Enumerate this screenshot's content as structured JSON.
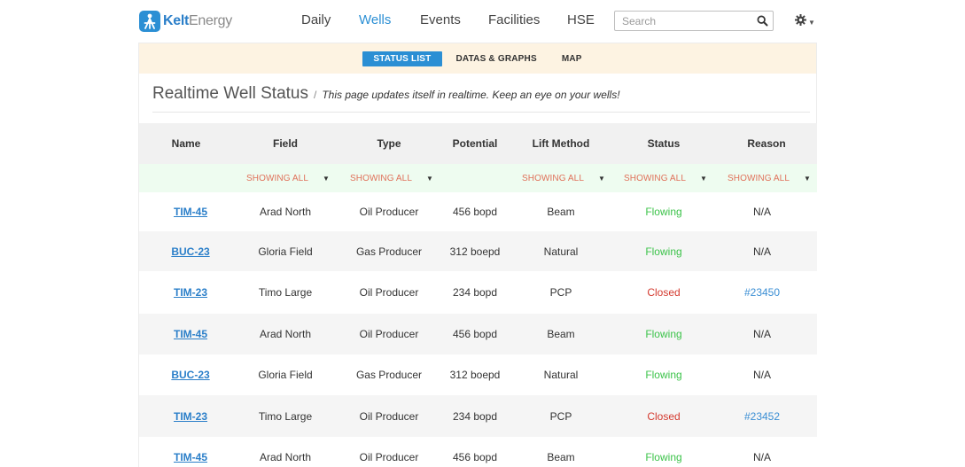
{
  "brand": {
    "name_part1": "Kelt",
    "name_part2": "Energy"
  },
  "nav": {
    "items": [
      {
        "label": "Daily"
      },
      {
        "label": "Wells",
        "active": true
      },
      {
        "label": "Events"
      },
      {
        "label": "Facilities"
      },
      {
        "label": "HSE"
      }
    ]
  },
  "search": {
    "placeholder": "Search",
    "value": ""
  },
  "subnav": {
    "tabs": [
      {
        "label": "STATUS LIST",
        "active": true
      },
      {
        "label": "DATAS & GRAPHS"
      },
      {
        "label": "MAP"
      }
    ]
  },
  "page": {
    "title": "Realtime Well Status",
    "separator": "/",
    "description": "This page updates itself in realtime. Keep an eye on your wells!"
  },
  "table": {
    "columns": [
      "Name",
      "Field",
      "Type",
      "Potential",
      "Lift Method",
      "Status",
      "Reason"
    ],
    "filter_label": "SHOWING ALL",
    "rows": [
      {
        "name": "TIM-45",
        "field": "Arad North",
        "type": "Oil Producer",
        "potential": "456 bopd",
        "lift": "Beam",
        "status": "Flowing",
        "reason": "N/A"
      },
      {
        "name": "BUC-23",
        "field": "Gloria Field",
        "type": "Gas Producer",
        "potential": "312 boepd",
        "lift": "Natural",
        "status": "Flowing",
        "reason": "N/A"
      },
      {
        "name": "TIM-23",
        "field": "Timo Large",
        "type": "Oil Producer",
        "potential": "234 bopd",
        "lift": "PCP",
        "status": "Closed",
        "reason": "#23450"
      },
      {
        "name": "TIM-45",
        "field": "Arad North",
        "type": "Oil Producer",
        "potential": "456 bopd",
        "lift": "Beam",
        "status": "Flowing",
        "reason": "N/A"
      },
      {
        "name": "BUC-23",
        "field": "Gloria Field",
        "type": "Gas Producer",
        "potential": "312 boepd",
        "lift": "Natural",
        "status": "Flowing",
        "reason": "N/A"
      },
      {
        "name": "TIM-23",
        "field": "Timo Large",
        "type": "Oil Producer",
        "potential": "234 bopd",
        "lift": "PCP",
        "status": "Closed",
        "reason": "#23452"
      },
      {
        "name": "TIM-45",
        "field": "Arad North",
        "type": "Oil Producer",
        "potential": "456 bopd",
        "lift": "Beam",
        "status": "Flowing",
        "reason": "N/A"
      }
    ]
  },
  "colors": {
    "accent": "#2b8fd4",
    "flowing": "#3cc34a",
    "closed": "#d43a2f",
    "filter_text": "#e0715a"
  }
}
